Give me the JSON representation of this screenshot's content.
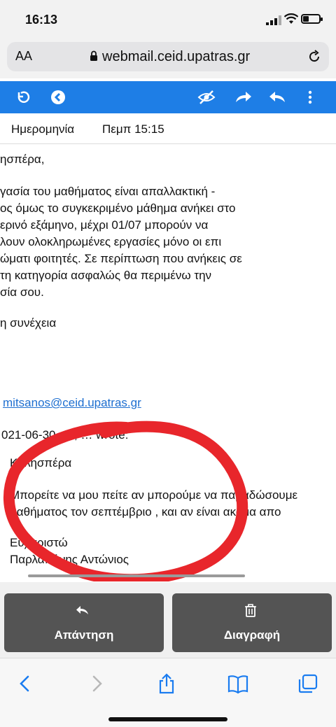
{
  "status": {
    "time": "16:13"
  },
  "browser": {
    "aa": "AA",
    "url": "webmail.ceid.upatras.gr"
  },
  "header": {
    "date_label": "Ημερομηνία",
    "date_value": "Πεμπ 15:15"
  },
  "body_lines": [
    "ησπέρα,",
    "γασία του μαθήματος είναι απαλλακτική -",
    "ος όμως το συγκεκριμένο μάθημα ανήκει στο",
    "ερινό εξάμηνο, μέχρι 01/07 μπορούν να",
    "λουν ολοκληρωμένες εργασίες μόνο οι επι",
    "ώματι φοιτητές. Σε περίπτωση που ανήκεις σε",
    " τη κατηγορία ασφαλώς θα περιμένω την",
    "σία σου.",
    "η συνέχεια"
  ],
  "email_link": "mitsanos@ceid.upatras.gr",
  "quote_header": "021-06-30 … , … wrote:",
  "quote_lines": [
    "Καλησπέρα",
    "Μπορείτε να μου πείτε αν μπορούμε να παραδώσουμε",
    "μαθήματος τον σεπτέμβριο , και αν είναι ακόμα απο",
    "Ευχαριστώ",
    "Παρλαπάνης Αντώνιος"
  ],
  "actions": {
    "reply": "Απάντηση",
    "delete": "Διαγραφή"
  },
  "colors": {
    "toolbar": "#1e7ee6",
    "annotation": "#e8262b",
    "link": "#1e6fd0"
  }
}
